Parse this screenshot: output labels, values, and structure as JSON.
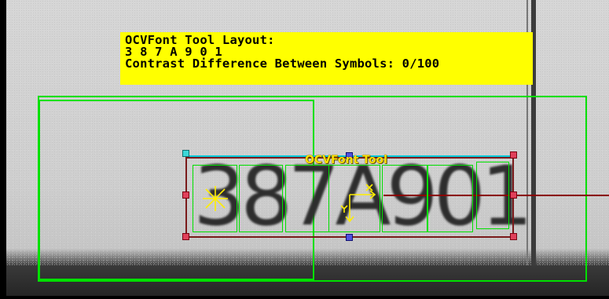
{
  "overlay": {
    "line1": "OCVFont Tool Layout:",
    "line2": "3 8 7 A 9 0 1",
    "line3": "Contrast Difference Between Symbols: 0/100"
  },
  "tool": {
    "label": "OCVFont Tool"
  },
  "image": {
    "text": "387A901"
  },
  "colors": {
    "overlay_bg": "#ffff00",
    "region": "#00e000",
    "tool_border": "#7a1a1a",
    "label": "#ffe000",
    "handle": "#e0405a"
  },
  "icons": [
    "crosshair-star-icon",
    "xy-axes-icon"
  ]
}
